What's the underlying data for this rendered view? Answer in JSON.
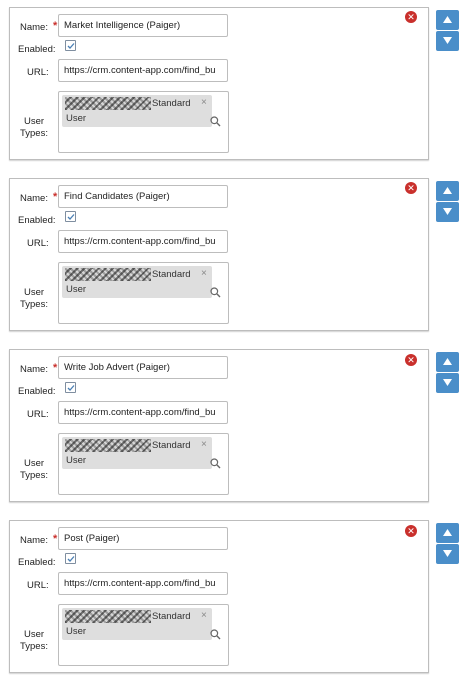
{
  "labels": {
    "name": "Name:",
    "required": "*",
    "enabled": "Enabled:",
    "url": "URL:",
    "user_types_line1": "User",
    "user_types_line2": "Types:"
  },
  "panels": [
    {
      "name": "Market Intelligence (Paiger)",
      "enabled": true,
      "url": "https://crm.content-app.com/find_bu",
      "user_type_tag": {
        "part1": "Standard",
        "part2": "User",
        "remove": "×"
      }
    },
    {
      "name": "Find Candidates (Paiger)",
      "enabled": true,
      "url": "https://crm.content-app.com/find_bu",
      "user_type_tag": {
        "part1": "Standard",
        "part2": "User",
        "remove": "×"
      }
    },
    {
      "name": "Write Job Advert (Paiger)",
      "enabled": true,
      "url": "https://crm.content-app.com/find_bu",
      "user_type_tag": {
        "part1": "Standard",
        "part2": "User",
        "remove": "×"
      }
    },
    {
      "name": "Post (Paiger)",
      "enabled": true,
      "url": "https://crm.content-app.com/find_bu",
      "user_type_tag": {
        "part1": "Standard",
        "part2": "User",
        "remove": "×"
      }
    }
  ],
  "icons": {
    "close": "close-circle-icon",
    "move_up": "arrow-up-icon",
    "move_down": "arrow-down-icon",
    "search": "search-icon",
    "checkbox": "checkmark-icon"
  },
  "colors": {
    "accent": "#4a8ec9",
    "danger": "#c9302c",
    "border": "#bdbdbd",
    "tag_bg": "#dedede"
  }
}
